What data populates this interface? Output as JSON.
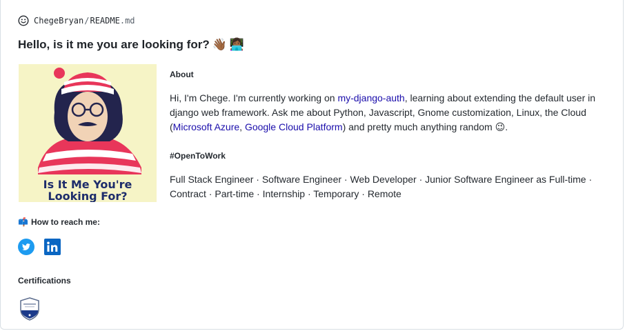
{
  "header": {
    "owner": "ChegeBryan",
    "separator": "/",
    "file_name": "README",
    "file_ext": ".md"
  },
  "readme": {
    "title": "Hello, is it me you are looking for?",
    "title_emojis": [
      "👋🏾",
      "👩🏾‍💻"
    ],
    "image": {
      "caption_line1": "Is It Me You're",
      "caption_line2": "Looking For?"
    },
    "about": {
      "heading": "About",
      "intro_before_link": "Hi, I'm Chege. I'm currently working on ",
      "project_link": "my-django-auth",
      "intro_after_link": ", learning about extending the default user in django web framework. Ask me about Python, Javascript, Gnome customization, Linux, the Cloud (",
      "azure_link": "Microsoft Azure",
      "comma": ", ",
      "gcp_link": "Google Cloud Platform",
      "intro_end": ") and pretty much anything random ",
      "wink_emoji": "😉",
      "period": "."
    },
    "open_to_work": {
      "heading": "#OpenToWork",
      "roles": "Full Stack Engineer · Software Engineer · Web Developer · Junior Software Engineer as Full-time · Contract · Part-time · Internship · Temporary · Remote"
    },
    "reach": {
      "emoji": "📫",
      "heading": "How to reach me:",
      "socials": [
        "twitter-icon",
        "linkedin-icon"
      ]
    },
    "certifications": {
      "heading": "Certifications",
      "badge": "azure-certification-badge"
    }
  },
  "colors": {
    "link": "#1a0dab",
    "twitter": "#1d9bf0",
    "linkedin": "#0a66c2",
    "image_bg": "#f6f4c6",
    "caption": "#1d2c6b"
  }
}
